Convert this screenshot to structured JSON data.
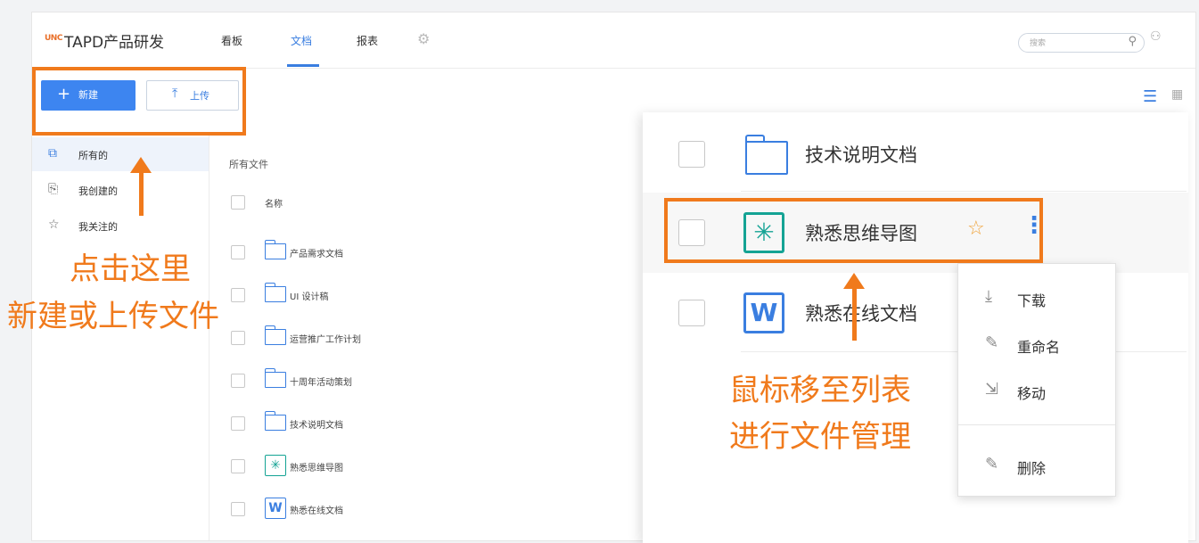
{
  "header": {
    "logo_badge": "UNC",
    "app_title": "TAPD产品研发",
    "tabs": [
      {
        "label": "看板"
      },
      {
        "label": "文档"
      },
      {
        "label": "报表"
      }
    ],
    "search_placeholder": "搜索"
  },
  "toolbar": {
    "new_label": "新建",
    "upload_label": "上传"
  },
  "sidebar": {
    "items": [
      {
        "label": "所有的",
        "icon": "document-stack-icon"
      },
      {
        "label": "我创建的",
        "icon": "create-doc-icon"
      },
      {
        "label": "我关注的",
        "icon": "star-icon"
      }
    ]
  },
  "main": {
    "breadcrumb": "所有文件",
    "column_header": "名称",
    "files": [
      {
        "name": "产品需求文档",
        "type": "folder"
      },
      {
        "name": "UI 设计稿",
        "type": "folder"
      },
      {
        "name": "运营推广工作计划",
        "type": "folder"
      },
      {
        "name": "十周年活动策划",
        "type": "folder"
      },
      {
        "name": "技术说明文档",
        "type": "folder"
      },
      {
        "name": "熟悉思维导图",
        "type": "mindmap"
      },
      {
        "name": "熟悉在线文档",
        "type": "word"
      }
    ]
  },
  "zoom": {
    "rows": [
      {
        "name": "技术说明文档",
        "type": "folder"
      },
      {
        "name": "熟悉思维导图",
        "type": "mindmap"
      },
      {
        "name": "熟悉在线文档",
        "type": "word"
      }
    ],
    "word_letter": "W"
  },
  "context_menu": {
    "items": [
      {
        "label": "下载",
        "icon": "download-icon"
      },
      {
        "label": "重命名",
        "icon": "edit-icon"
      },
      {
        "label": "移动",
        "icon": "move-icon"
      },
      {
        "label": "删除",
        "icon": "delete-icon"
      }
    ]
  },
  "annotations": {
    "left_line1": "点击这里",
    "left_line2": "新建或上传文件",
    "right_line1": "鼠标移至列表",
    "right_line2": "进行文件管理"
  },
  "colors": {
    "accent": "#3a7ee0",
    "highlight": "#f07a1c",
    "mindmap": "#14a394",
    "star": "#f0a33a"
  }
}
